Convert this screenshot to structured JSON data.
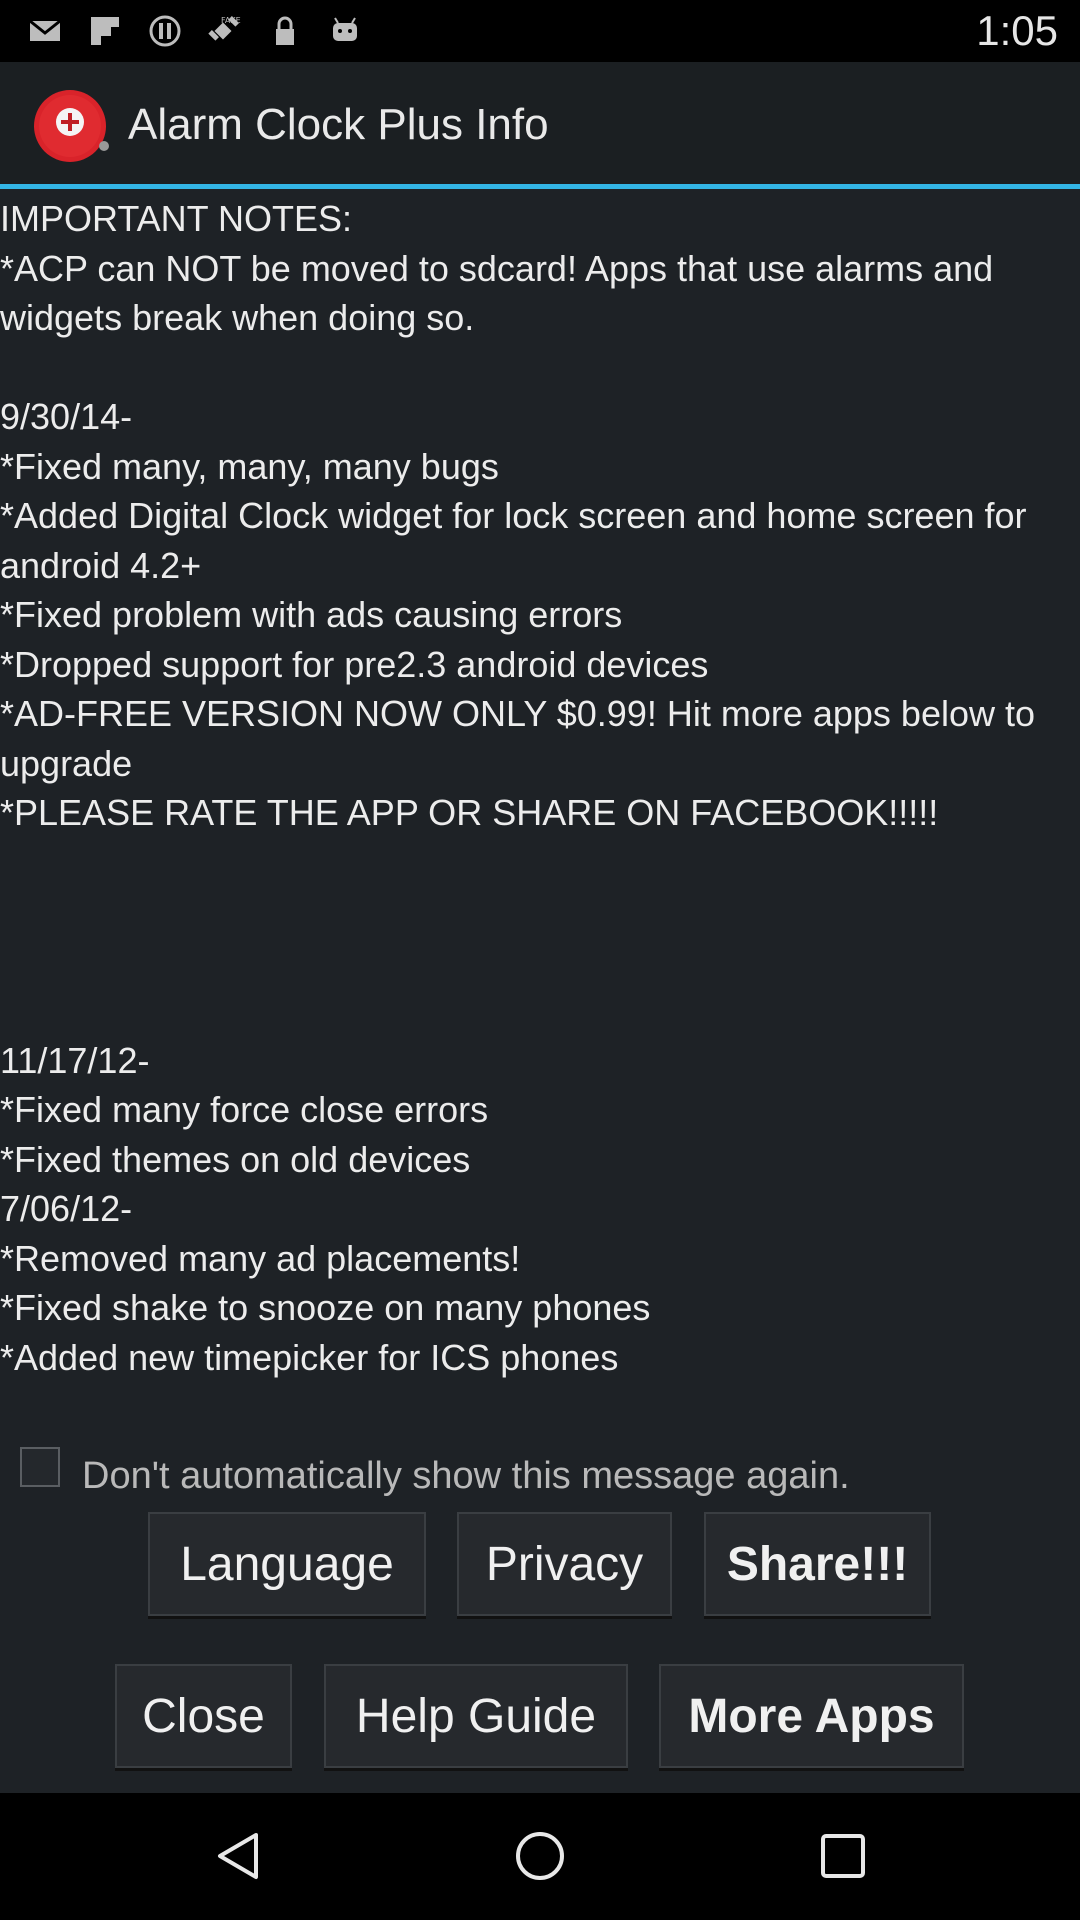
{
  "status_bar": {
    "time": "1:05",
    "icons": [
      "gmail-icon",
      "flipboard-icon",
      "alert-icon",
      "gps-fake-icon",
      "lock-icon",
      "android-icon"
    ]
  },
  "title_bar": {
    "app_icon": "alarm-clock-plus-icon",
    "title": "Alarm Clock Plus Info"
  },
  "notes": {
    "text": "IMPORTANT NOTES:\n*ACP can NOT be moved to sdcard! Apps that use alarms and widgets break when doing so.\n\n9/30/14-\n*Fixed many, many, many bugs\n*Added Digital Clock widget for lock screen and home screen for android 4.2+\n*Fixed problem with ads causing errors\n*Dropped support for pre2.3 android devices\n*AD-FREE VERSION NOW ONLY $0.99! Hit more apps below to upgrade\n*PLEASE RATE THE APP OR SHARE ON FACEBOOK!!!!!\n\n\n\n\n11/17/12-\n*Fixed many force close errors\n*Fixed themes on old devices\n7/06/12-\n*Removed many ad placements!\n*Fixed shake to snooze on many phones\n*Added new timepicker for ICS phones"
  },
  "checkbox": {
    "label": "Don't automatically show this message again.",
    "checked": false
  },
  "buttons": {
    "language": "Language",
    "privacy": "Privacy",
    "share": "Share!!!",
    "close": "Close",
    "help_guide": "Help Guide",
    "more_apps": "More Apps"
  },
  "nav_bar": {
    "icons": [
      "back-icon",
      "home-icon",
      "recents-icon"
    ]
  },
  "colors": {
    "accent": "#33b5e5",
    "background": "#1e2226",
    "app_icon_red": "#d9232a"
  }
}
